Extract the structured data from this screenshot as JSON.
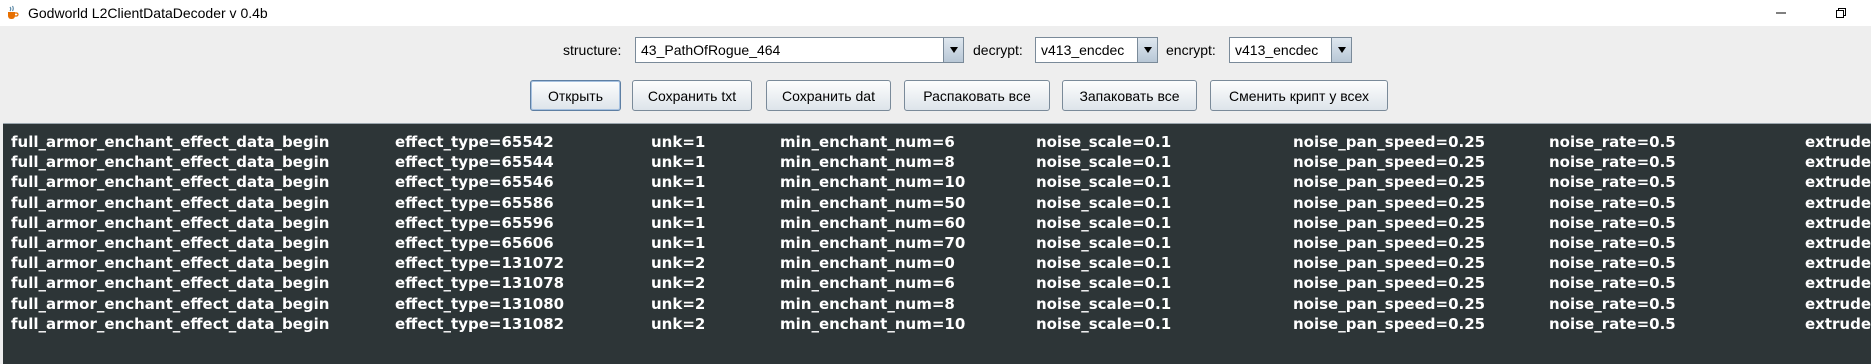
{
  "window": {
    "title": "Godworld L2ClientDataDecoder v 0.4b",
    "icon": "java-cup-icon",
    "controls": [
      "minimize-icon",
      "restore-icon"
    ]
  },
  "toolbar": {
    "structure_label": "structure:",
    "structure_value": "43_PathOfRogue_464",
    "decrypt_label": "decrypt:",
    "decrypt_value": "v413_encdec",
    "encrypt_label": "encrypt:",
    "encrypt_value": "v413_encdec"
  },
  "buttons": {
    "open": "Открыть",
    "save_txt": "Сохранить txt",
    "save_dat": "Сохранить dat",
    "unpack_all": "Распаковать все",
    "pack_all": "Запаковать все",
    "change_crypt": "Сменить крипт у всех"
  },
  "text_area": {
    "background": "#2d3537",
    "rows": [
      [
        "full_armor_enchant_effect_data_begin",
        "effect_type=65542",
        "unk=1",
        "min_enchant_num=6",
        "noise_scale=0.1",
        "noise_pan_speed=0.25",
        "noise_rate=0.5",
        "extrude_"
      ],
      [
        "full_armor_enchant_effect_data_begin",
        "effect_type=65544",
        "unk=1",
        "min_enchant_num=8",
        "noise_scale=0.1",
        "noise_pan_speed=0.25",
        "noise_rate=0.5",
        "extrude_"
      ],
      [
        "full_armor_enchant_effect_data_begin",
        "effect_type=65546",
        "unk=1",
        "min_enchant_num=10",
        "noise_scale=0.1",
        "noise_pan_speed=0.25",
        "noise_rate=0.5",
        "extrude_"
      ],
      [
        "full_armor_enchant_effect_data_begin",
        "effect_type=65586",
        "unk=1",
        "min_enchant_num=50",
        "noise_scale=0.1",
        "noise_pan_speed=0.25",
        "noise_rate=0.5",
        "extrude_"
      ],
      [
        "full_armor_enchant_effect_data_begin",
        "effect_type=65596",
        "unk=1",
        "min_enchant_num=60",
        "noise_scale=0.1",
        "noise_pan_speed=0.25",
        "noise_rate=0.5",
        "extrude_"
      ],
      [
        "full_armor_enchant_effect_data_begin",
        "effect_type=65606",
        "unk=1",
        "min_enchant_num=70",
        "noise_scale=0.1",
        "noise_pan_speed=0.25",
        "noise_rate=0.5",
        "extrude_"
      ],
      [
        "full_armor_enchant_effect_data_begin",
        "effect_type=131072",
        "unk=2",
        "min_enchant_num=0",
        "noise_scale=0.1",
        "noise_pan_speed=0.25",
        "noise_rate=0.5",
        "extrude_"
      ],
      [
        "full_armor_enchant_effect_data_begin",
        "effect_type=131078",
        "unk=2",
        "min_enchant_num=6",
        "noise_scale=0.1",
        "noise_pan_speed=0.25",
        "noise_rate=0.5",
        "extrude_"
      ],
      [
        "full_armor_enchant_effect_data_begin",
        "effect_type=131080",
        "unk=2",
        "min_enchant_num=8",
        "noise_scale=0.1",
        "noise_pan_speed=0.25",
        "noise_rate=0.5",
        "extrude_"
      ],
      [
        "full_armor_enchant_effect_data_begin",
        "effect_type=131082",
        "unk=2",
        "min_enchant_num=10",
        "noise_scale=0.1",
        "noise_pan_speed=0.25",
        "noise_rate=0.5",
        "extrude_"
      ]
    ]
  }
}
